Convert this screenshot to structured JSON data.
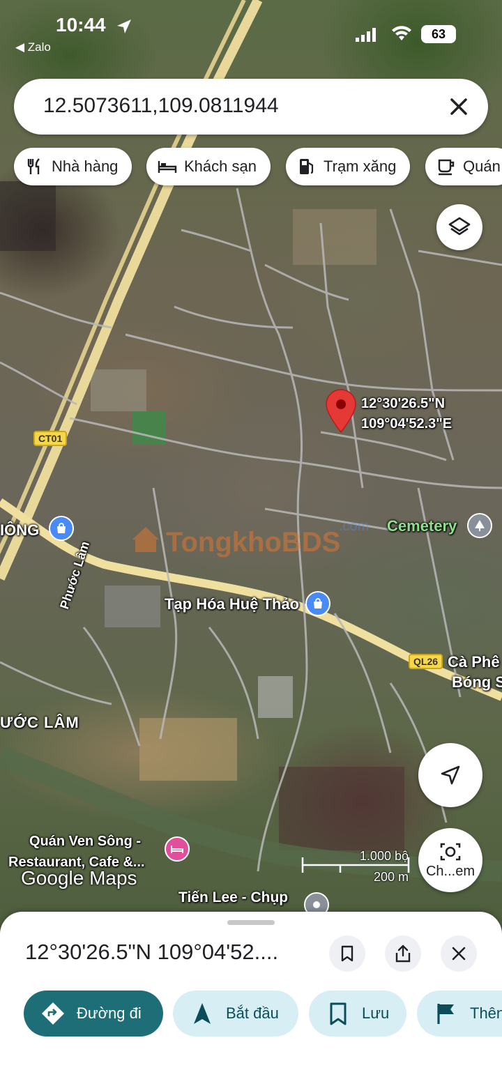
{
  "status_bar": {
    "time": "10:44",
    "back_app": "◀ Zalo",
    "battery": "63"
  },
  "search": {
    "query": "12.5073611,109.0811944"
  },
  "categories": [
    {
      "label": "Nhà hàng",
      "icon": "fork-knife-icon"
    },
    {
      "label": "Khách sạn",
      "icon": "bed-icon"
    },
    {
      "label": "Trạm xăng",
      "icon": "gas-pump-icon"
    },
    {
      "label": "Quán",
      "icon": "coffee-icon"
    }
  ],
  "map": {
    "pin_label_lat": "12°30'26.5\"N",
    "pin_label_lng": "109°04'52.3\"E",
    "roads": {
      "ct01": "CT01",
      "ql26": "QL26",
      "phuoc_lam_street": "Phước Lâm"
    },
    "places": {
      "left_edge": "IÔNG",
      "cemetery": "Cemetery",
      "tap_hoa": "Tạp Hóa Huệ Thảo",
      "ca_phe_line1": "Cà Phê",
      "ca_phe_line2": "Bóng S",
      "phuoc_lam_area": "ƯỚC LÂM",
      "quan_ven_song_line1": "Quán Ven Sông -",
      "quan_ven_song_line2": "Restaurant, Cafe &...",
      "tien_lee": "Tiến Lee - Chụp"
    },
    "watermark": "TongkhoBDS",
    "watermark_suffix": ".com",
    "scale": {
      "feet": "1.000 bộ",
      "meters": "200 m"
    },
    "logo": "Google Maps",
    "lens_label": "Ch...em"
  },
  "sheet": {
    "title": "12°30'26.5\"N 109°04'52....",
    "actions": [
      {
        "label": "Đường đi",
        "icon": "directions-icon"
      },
      {
        "label": "Bắt đầu",
        "icon": "navigate-arrow-icon"
      },
      {
        "label": "Lưu",
        "icon": "bookmark-icon"
      },
      {
        "label": "Thên",
        "icon": "flag-icon"
      }
    ]
  },
  "colors": {
    "primary_action": "#1d6e76",
    "secondary_action": "#d7eef5",
    "pin": "#e53935"
  }
}
